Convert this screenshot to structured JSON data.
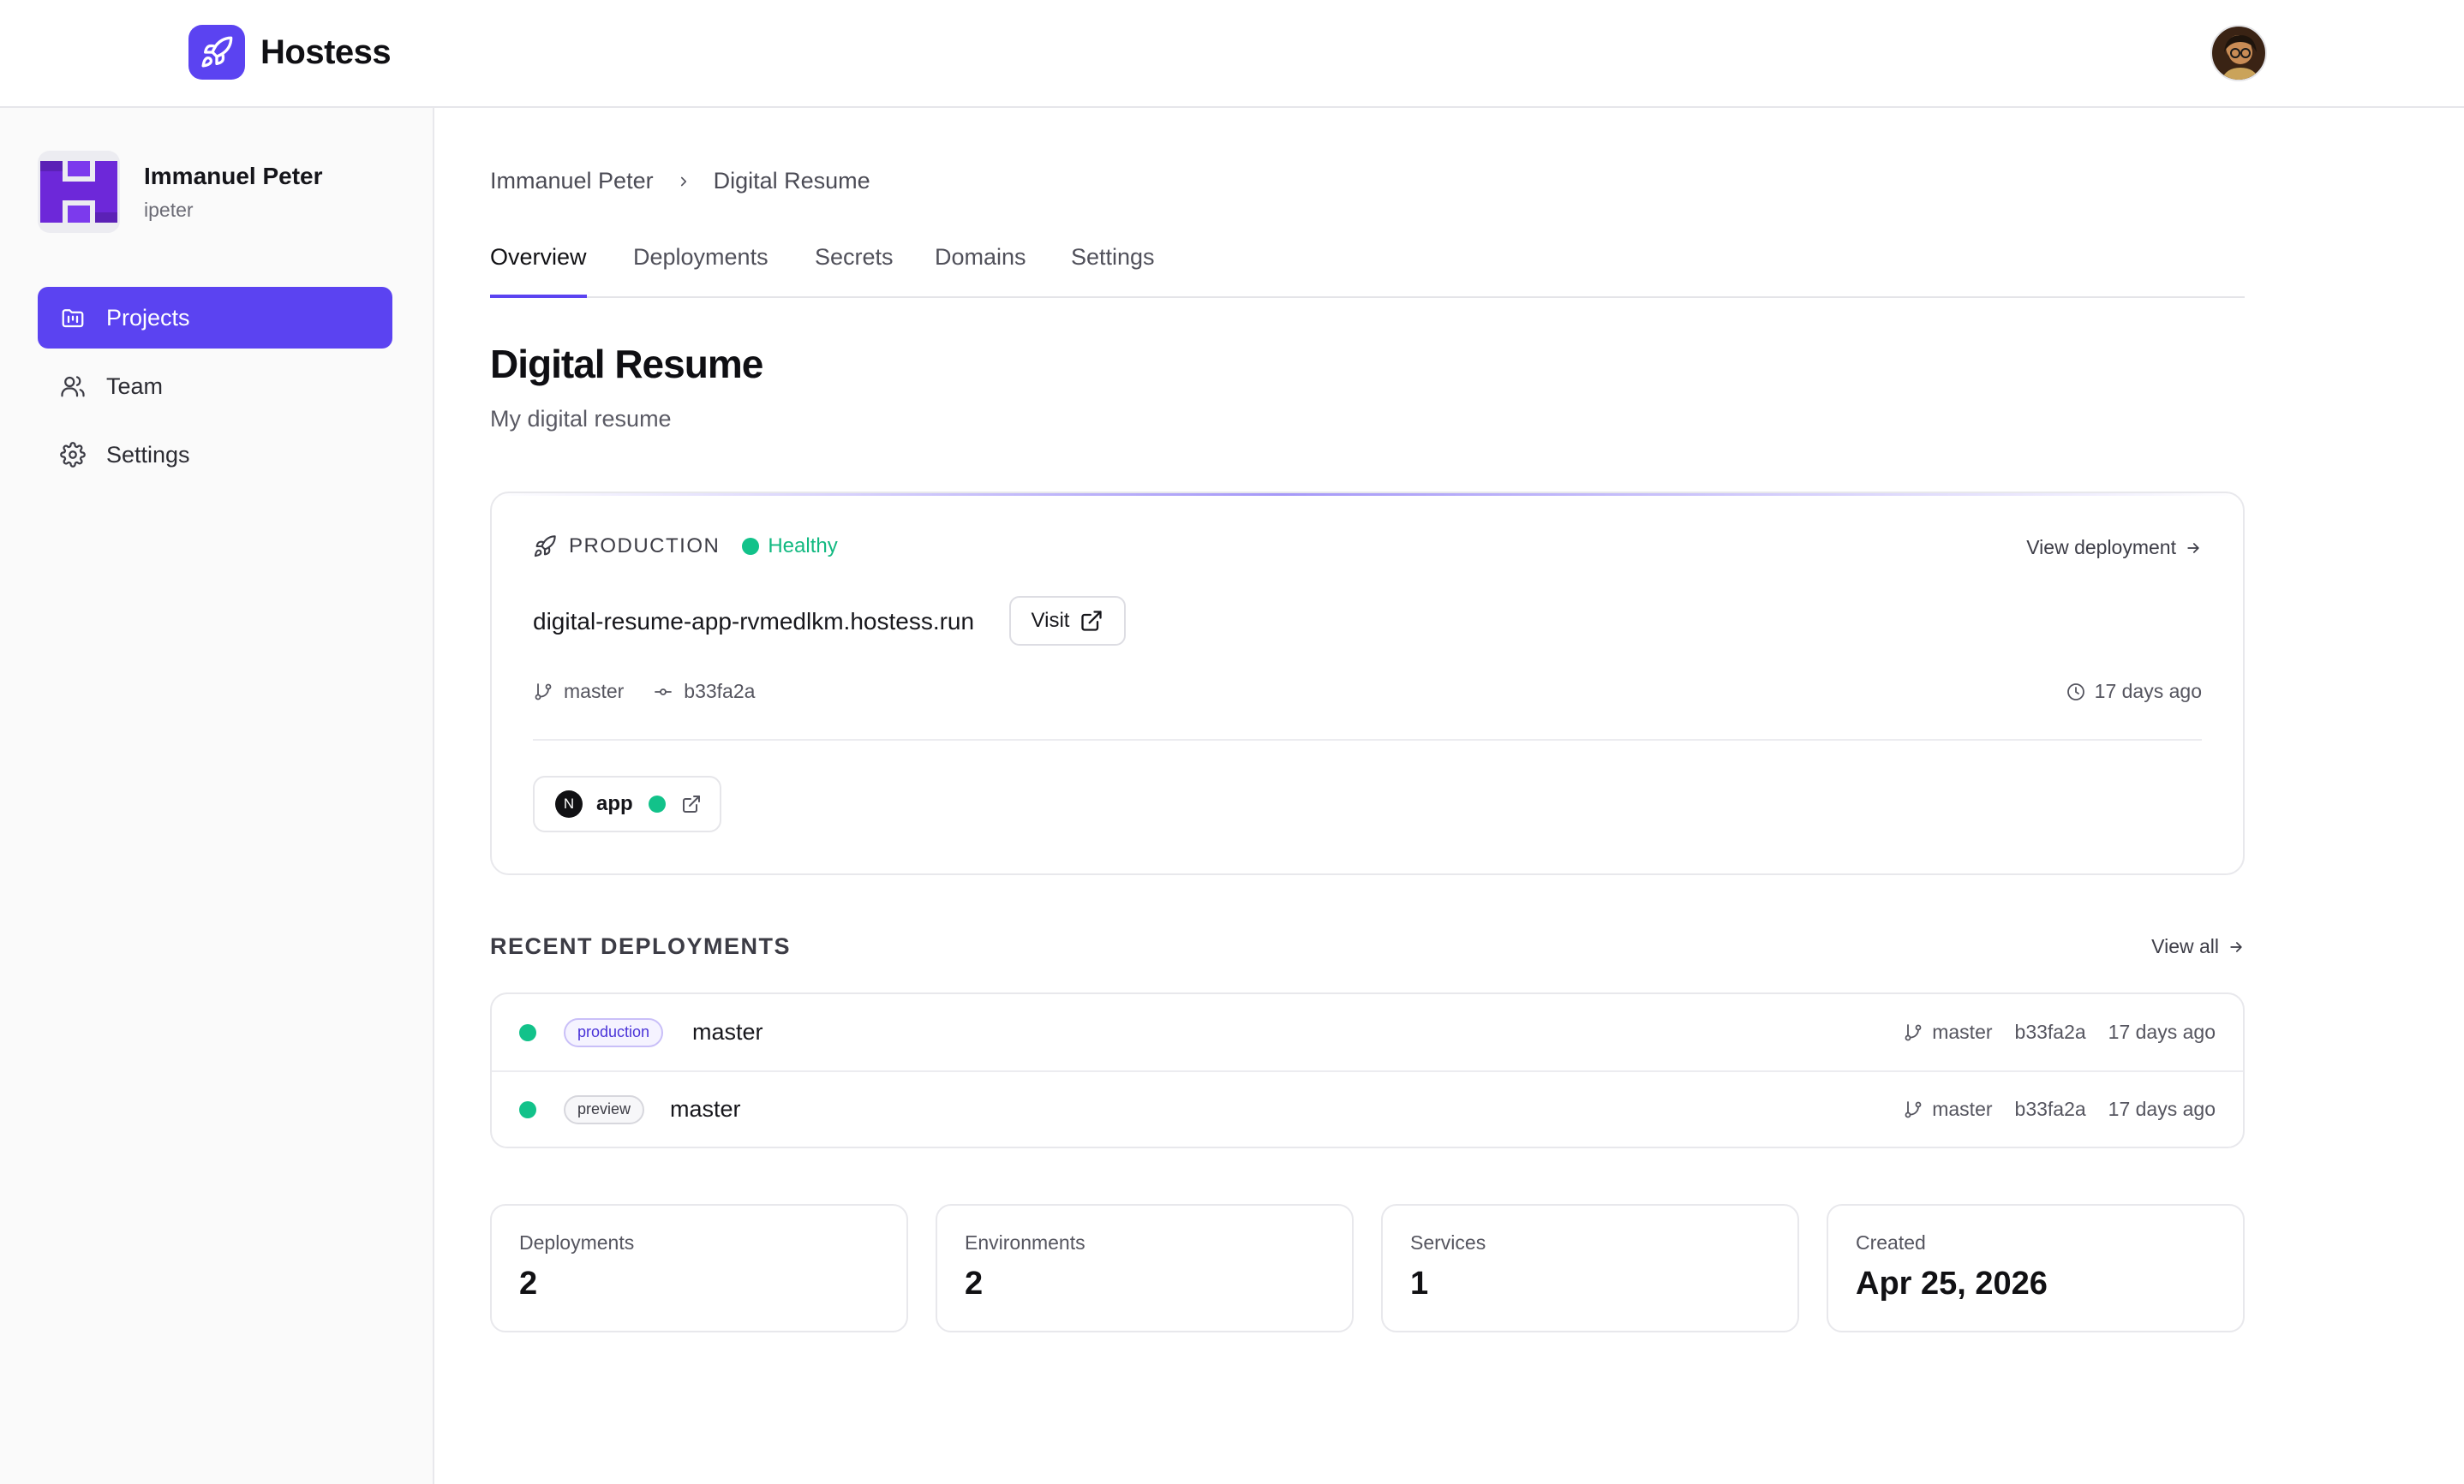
{
  "app": {
    "name": "Hostess"
  },
  "colors": {
    "accent": "#5b43f1",
    "healthy": "#12c28a"
  },
  "sidebar": {
    "org": {
      "name": "Immanuel Peter",
      "handle": "ipeter"
    },
    "items": [
      {
        "label": "Projects",
        "icon": "folder-icon",
        "active": true
      },
      {
        "label": "Team",
        "icon": "users-icon",
        "active": false
      },
      {
        "label": "Settings",
        "icon": "gear-icon",
        "active": false
      }
    ]
  },
  "breadcrumb": [
    "Immanuel Peter",
    "Digital Resume"
  ],
  "tabs": [
    {
      "label": "Overview",
      "active": true
    },
    {
      "label": "Deployments",
      "active": false
    },
    {
      "label": "Secrets",
      "active": false
    },
    {
      "label": "Domains",
      "active": false
    },
    {
      "label": "Settings",
      "active": false
    }
  ],
  "project": {
    "title": "Digital Resume",
    "description": "My digital resume"
  },
  "production": {
    "label": "PRODUCTION",
    "status": "Healthy",
    "view_label": "View deployment",
    "url": "digital-resume-app-rvmedlkm.hostess.run",
    "visit_label": "Visit",
    "branch": "master",
    "commit": "b33fa2a",
    "time": "17 days ago",
    "service": {
      "badge": "N",
      "name": "app"
    }
  },
  "recent": {
    "title": "RECENT DEPLOYMENTS",
    "view_all": "View all",
    "rows": [
      {
        "env": "production",
        "branch": "master",
        "meta_branch": "master",
        "commit": "b33fa2a",
        "time": "17 days ago"
      },
      {
        "env": "preview",
        "branch": "master",
        "meta_branch": "master",
        "commit": "b33fa2a",
        "time": "17 days ago"
      }
    ]
  },
  "stats": [
    {
      "label": "Deployments",
      "value": "2"
    },
    {
      "label": "Environments",
      "value": "2"
    },
    {
      "label": "Services",
      "value": "1"
    },
    {
      "label": "Created",
      "value": "Apr 25, 2026"
    }
  ]
}
